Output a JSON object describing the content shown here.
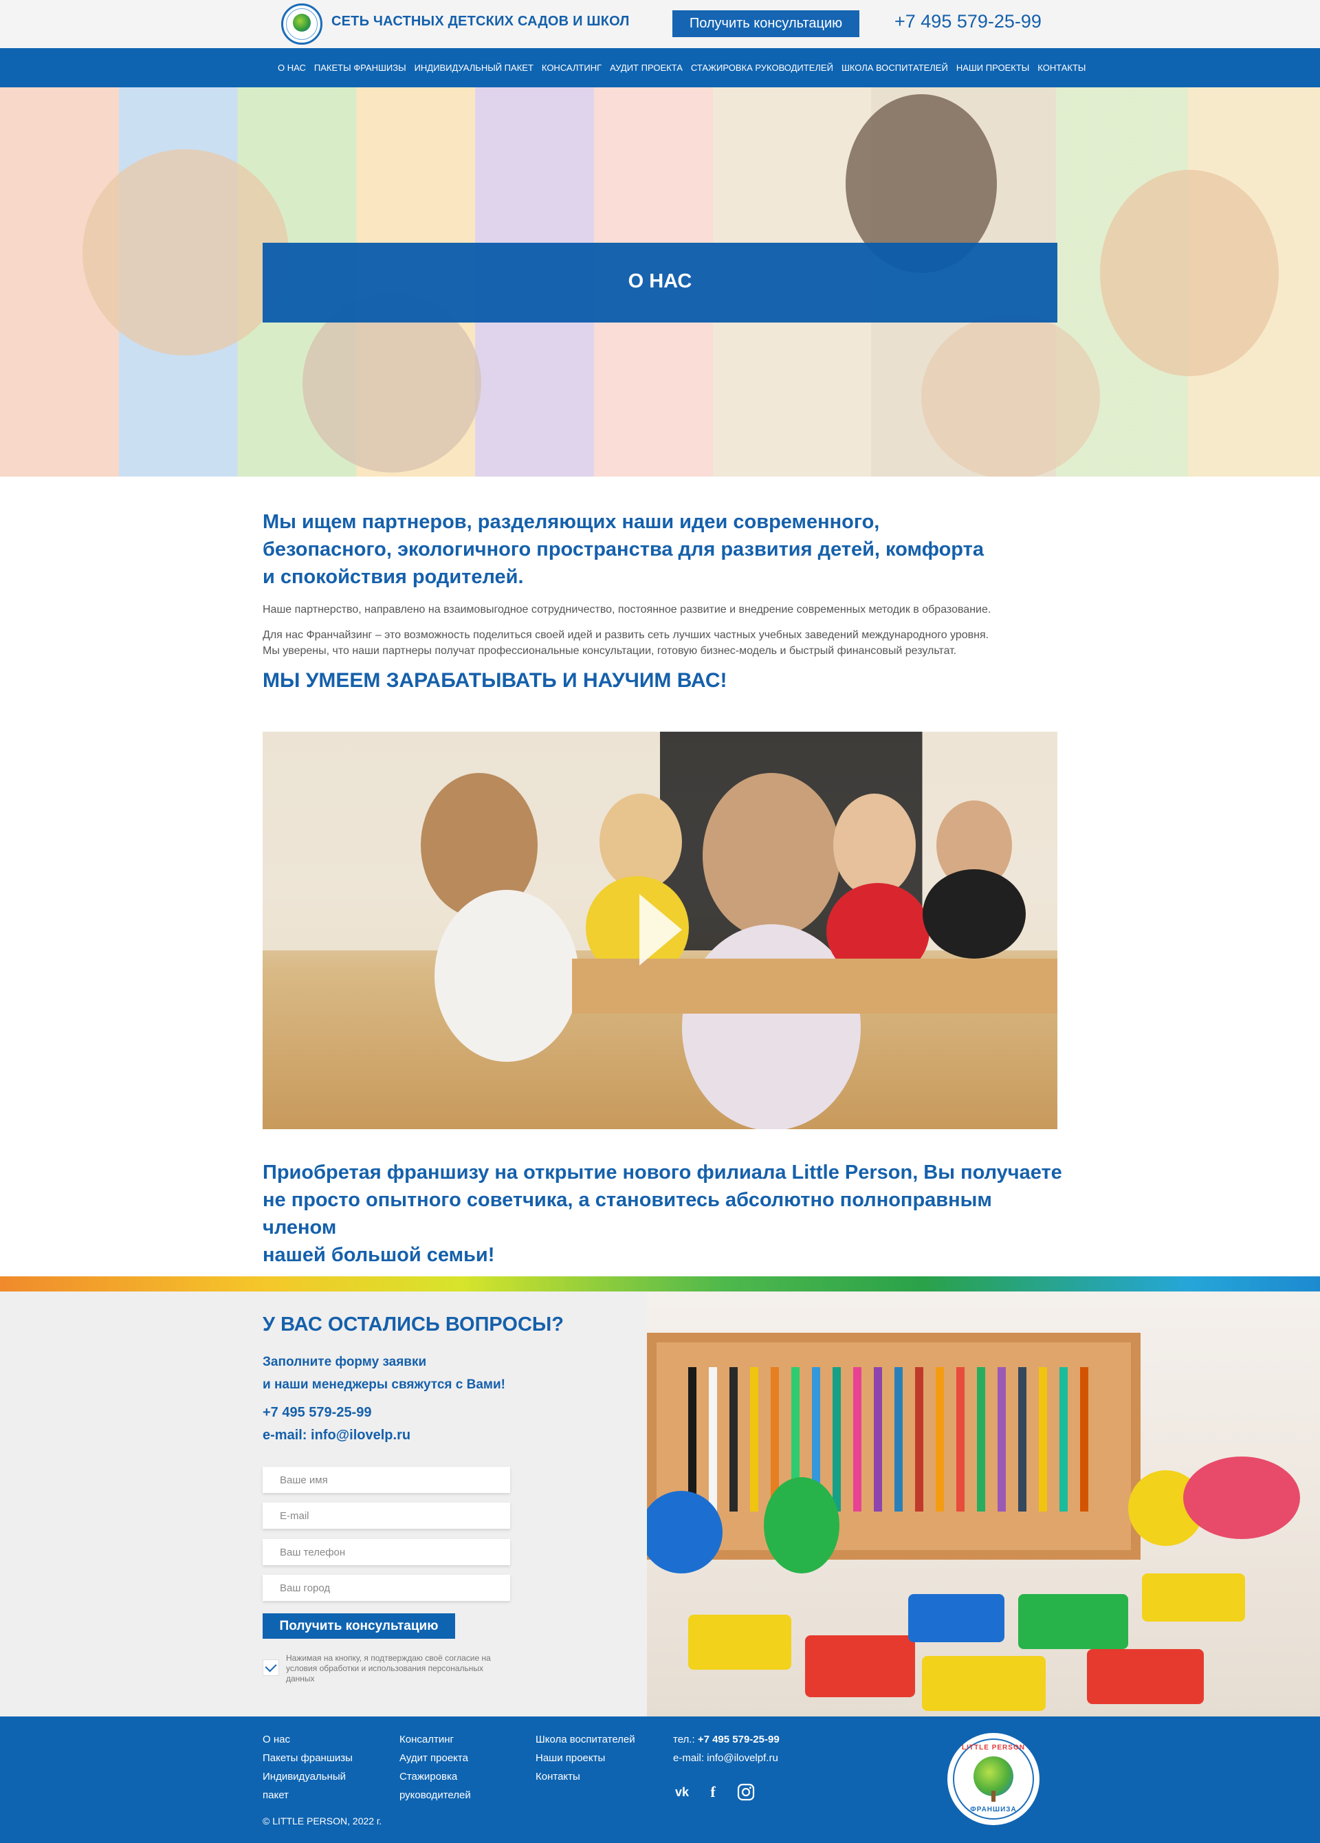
{
  "header": {
    "brand": "СЕТЬ ЧАСТНЫХ ДЕТСКИХ САДОВ И ШКОЛ",
    "cta_label": "Получить консультацию",
    "phone": "+7 495 579-25-99",
    "accent_color": "#1565b3"
  },
  "nav": {
    "items": [
      {
        "label": "О НАС"
      },
      {
        "label": "ПАКЕТЫ ФРАНШИЗЫ"
      },
      {
        "label": "ИНДИВИДУАЛЬНЫЙ ПАКЕТ"
      },
      {
        "label": "КОНСАЛТИНГ"
      },
      {
        "label": "АУДИТ ПРОЕКТА"
      },
      {
        "label": "СТАЖИРОВКА РУКОВОДИТЕЛЕЙ"
      },
      {
        "label": "ШКОЛА ВОСПИТАТЕЛЕЙ"
      },
      {
        "label": "НАШИ ПРОЕКТЫ"
      },
      {
        "label": "КОНТАКТЫ"
      }
    ]
  },
  "hero": {
    "title": "О НАС"
  },
  "main": {
    "heading_lines": [
      "Мы ищем партнеров, разделяющих наши идеи современного,",
      "безопасного, экологичного пространства для развития детей, комфорта",
      "и спокойствия родителей."
    ],
    "paragraph1": "Наше партнерство, направлено на взаимовыгодное сотрудничество, постоянное развитие и внедрение современных методик в образование.",
    "paragraph2_lines": [
      "Для нас Франчайзинг – это возможность поделиться своей идей и развить сеть лучших частных учебных заведений международного уровня.",
      "Мы уверены, что наши партнеры получат профессиональные консультации, готовую бизнес-модель и быстрый финансовый результат."
    ],
    "slogan": "МЫ УМЕЕМ ЗАРАБАТЫВАТЬ И НАУЧИМ ВАС!",
    "video_icon": "play-icon",
    "closing_lines": [
      "Приобретая франшизу на открытие нового филиала Little Person, Вы получаете",
      "не просто опытного советчика, а становитесь абсолютно полноправным членом",
      "нашей большой семьи!"
    ]
  },
  "contact": {
    "title": "У ВАС ОСТАЛИСЬ ВОПРОСЫ?",
    "subtitle_lines": [
      "Заполните форму заявки",
      "и наши менеджеры свяжутся с Вами!"
    ],
    "phone": "+7 495 579-25-99",
    "email": "e-mail: info@ilovelp.ru",
    "fields": {
      "name_placeholder": "Ваше имя",
      "email_placeholder": "E-mail",
      "phone_placeholder": "Ваш телефон",
      "city_placeholder": "Ваш город"
    },
    "submit_label": "Получить консультацию",
    "consent_checked": true,
    "consent_text": "Нажимая на кнопку, я подтверждаю своё согласие на условия обработки и использования персональных данных"
  },
  "footer": {
    "col1": [
      "О нас",
      "Пакеты франшизы",
      "Индивидуальный",
      "пакет"
    ],
    "col2": [
      "Консалтинг",
      "Аудит проекта",
      "Стажировка",
      "руководителей"
    ],
    "col3": [
      "Школа воспитателей",
      "Наши проекты",
      "Контакты"
    ],
    "phone_label": "тел.:",
    "phone": "+7 495 579-25-99",
    "email": "e-mail: info@ilovelpf.ru",
    "social": [
      "vk-icon",
      "facebook-icon",
      "instagram-icon"
    ],
    "copyright": "© LITTLE PERSON, 2022 г.",
    "logo_top": "LITTLE PERSON",
    "logo_bottom": "ФРАНШИЗА"
  }
}
